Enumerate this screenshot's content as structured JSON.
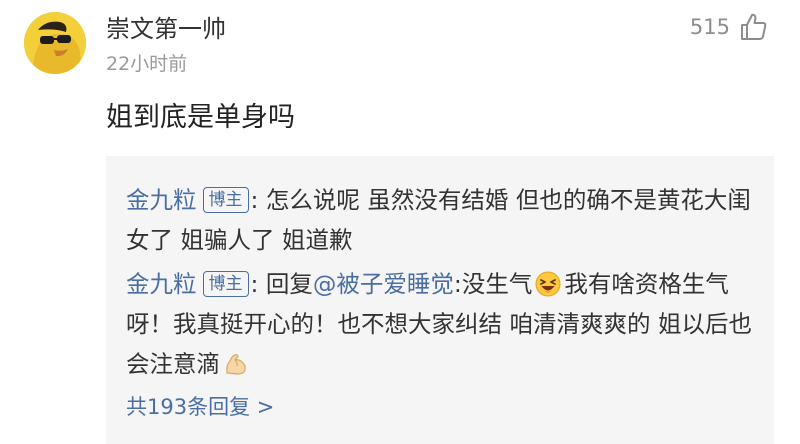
{
  "comment": {
    "avatar_icon": "yellow-chick-sunglasses-avatar",
    "username": "崇文第一帅",
    "timestamp": "22小时前",
    "like_count": "515",
    "like_icon": "thumbs-up-icon",
    "text": "姐到底是单身吗"
  },
  "replies": [
    {
      "author": "金九粒",
      "badge": "博主",
      "separator": ":",
      "text": " 怎么说呢 虽然没有结婚 但也的确不是黄花大闺女了 姐骗人了 姐道歉"
    },
    {
      "author": "金九粒",
      "badge": "博主",
      "separator": ":",
      "prefix": " 回复",
      "mention": "@被子爱睡觉",
      "text_before_emoji": ":没生气",
      "emoji_1": "laughing-face-emoji",
      "text_after_emoji": "我有啥资格生气呀！我真挺开心的！也不想大家纠结 咱清清爽爽的 姐以后也会注意滴",
      "emoji_2": "flexed-biceps-emoji"
    }
  ],
  "more_replies_label": "共193条回复 >",
  "colors": {
    "link_blue": "#4a6ea3",
    "reply_background": "#f5f5f5",
    "meta_gray": "#9a9a9a"
  }
}
